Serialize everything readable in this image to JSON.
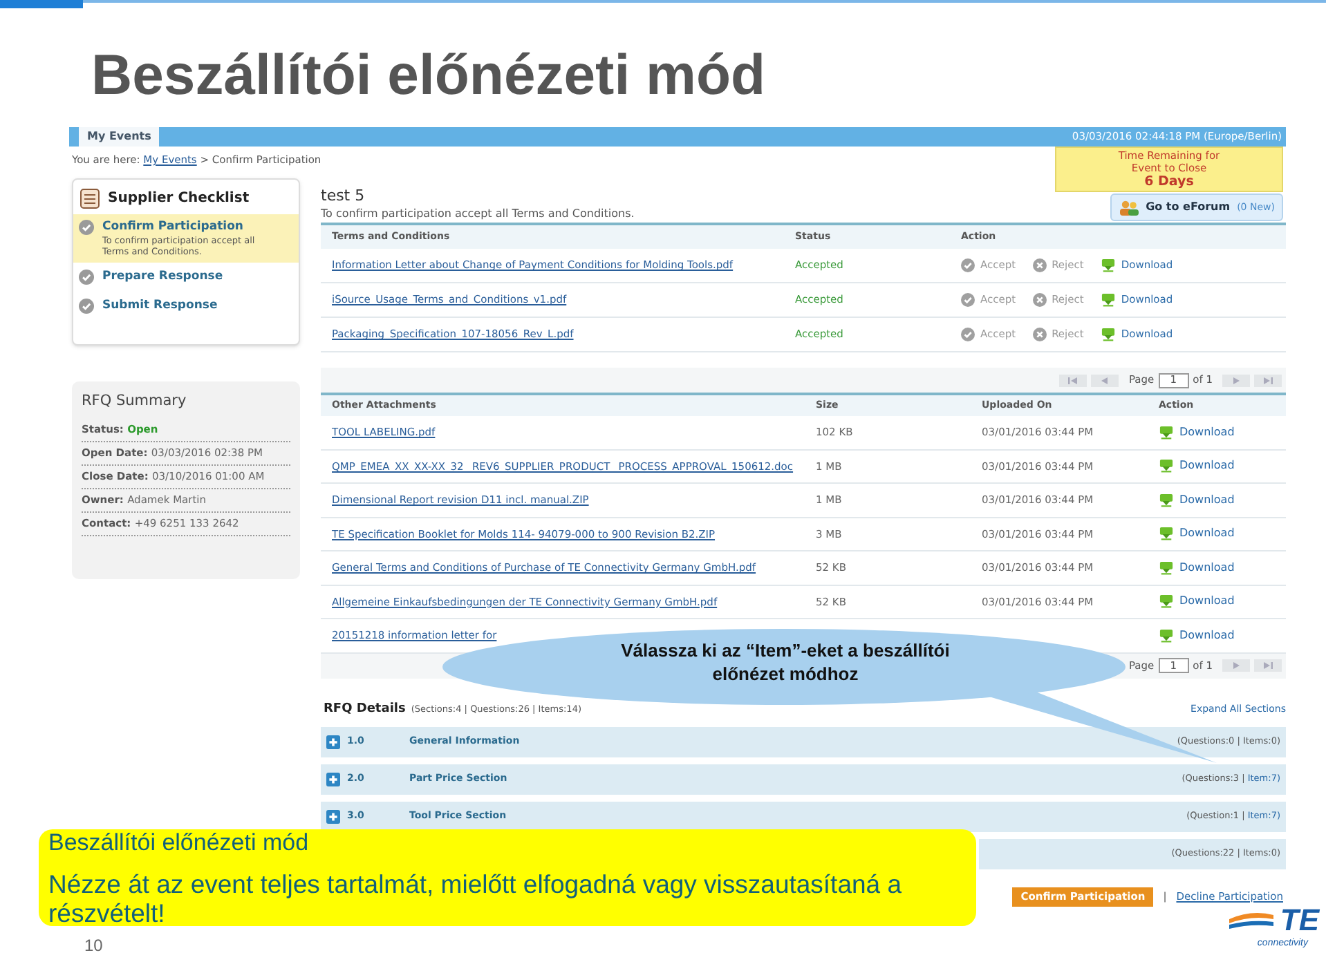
{
  "slide": {
    "title": "Beszállítói előnézeti mód",
    "page_number": "10"
  },
  "app": {
    "tab": "My Events",
    "datetime": "03/03/2016 02:44:18 PM (Europe/Berlin)",
    "breadcrumb": {
      "label": "You are here:",
      "link": "My Events",
      "separator": ">",
      "current": "Confirm Participation"
    }
  },
  "time_remaining": {
    "label": "Time Remaining for Event to Close",
    "value": "6 Days"
  },
  "checklist": {
    "title": "Supplier Checklist",
    "steps": [
      {
        "label": "Confirm Participation",
        "description": "To confirm participation accept all Terms and Conditions.",
        "selected": true
      },
      {
        "label": "Prepare Response",
        "selected": false
      },
      {
        "label": "Submit Response",
        "selected": false
      }
    ]
  },
  "rfq_summary": {
    "title": "RFQ Summary",
    "fields": [
      {
        "label": "Status:",
        "value": "Open",
        "kind": "status"
      },
      {
        "label": "Open Date:",
        "value": "03/03/2016 02:38 PM",
        "kind": "plain"
      },
      {
        "label": "Close Date:",
        "value": "03/10/2016 01:00 AM",
        "kind": "plain"
      },
      {
        "label": "Owner:",
        "value": "Adamek Martin",
        "kind": "plain"
      },
      {
        "label": "Contact:",
        "value": "+49 6251 133 2642",
        "kind": "plain"
      }
    ]
  },
  "event": {
    "name": "test 5",
    "instruction": "To confirm participation accept all Terms and Conditions."
  },
  "eforum_button": {
    "label": "Go to eForum",
    "badge": "(0 New)"
  },
  "terms_table": {
    "columns": [
      "Terms and Conditions",
      "Status",
      "Action"
    ],
    "rows": [
      {
        "name": "Information Letter about Change of Payment Conditions for Molding Tools.pdf",
        "status": "Accepted",
        "actions": [
          {
            "kind": "accept",
            "label": "Accept",
            "disabled": true
          },
          {
            "kind": "reject",
            "label": "Reject",
            "disabled": true
          },
          {
            "kind": "download",
            "label": "Download",
            "disabled": false
          }
        ]
      },
      {
        "name": "iSource_Usage_Terms_and_Conditions_v1.pdf",
        "status": "Accepted",
        "actions": [
          {
            "kind": "accept",
            "label": "Accept",
            "disabled": true
          },
          {
            "kind": "reject",
            "label": "Reject",
            "disabled": true
          },
          {
            "kind": "download",
            "label": "Download",
            "disabled": false
          }
        ]
      },
      {
        "name": "Packaging_Specification_107-18056_Rev_L.pdf",
        "status": "Accepted",
        "actions": [
          {
            "kind": "accept",
            "label": "Accept",
            "disabled": true
          },
          {
            "kind": "reject",
            "label": "Reject",
            "disabled": true
          },
          {
            "kind": "download",
            "label": "Download",
            "disabled": false
          }
        ]
      }
    ]
  },
  "pager_top": {
    "label": "Page",
    "value": "1",
    "total": "of 1"
  },
  "attachments_table": {
    "columns": [
      "Other Attachments",
      "Size",
      "Uploaded On",
      "Action"
    ],
    "rows": [
      {
        "name": "TOOL LABELING.pdf",
        "size": "102 KB",
        "uploaded": "03/01/2016 03:44 PM",
        "action": "Download"
      },
      {
        "name": "QMP_EMEA_XX_XX-XX_32 _REV6_SUPPLIER_PRODUCT _PROCESS_APPROVAL_150612.doc",
        "size": "1 MB",
        "uploaded": "03/01/2016 03:44 PM",
        "action": "Download"
      },
      {
        "name": "Dimensional Report revision D11 incl. manual.ZIP",
        "size": "1 MB",
        "uploaded": "03/01/2016 03:44 PM",
        "action": "Download"
      },
      {
        "name": "TE Specification Booklet for Molds 114- 94079-000 to 900 Revision B2.ZIP",
        "size": "3 MB",
        "uploaded": "03/01/2016 03:44 PM",
        "action": "Download"
      },
      {
        "name": "General Terms and Conditions of Purchase of TE Connectivity Germany GmbH.pdf",
        "size": "52 KB",
        "uploaded": "03/01/2016 03:44 PM",
        "action": "Download"
      },
      {
        "name": "Allgemeine Einkaufsbedingungen der TE Connectivity Germany GmbH.pdf",
        "size": "52 KB",
        "uploaded": "03/01/2016 03:44 PM",
        "action": "Download"
      },
      {
        "name": "20151218 information letter for",
        "action": "Download"
      }
    ]
  },
  "pager_bottom": {
    "label": "Page",
    "value": "1",
    "total": "of 1"
  },
  "rfq_details": {
    "title": "RFQ Details",
    "summary": "(Sections:4 | Questions:26 | Items:14)",
    "expand_link": "Expand All Sections",
    "sections": [
      {
        "number": "1.0",
        "title": "General Information",
        "questions": "(Questions:0 |",
        "items": "Items:0)",
        "items_link": false
      },
      {
        "number": "2.0",
        "title": "Part Price Section",
        "questions": "(Questions:3 |",
        "items": "Item:7)",
        "items_link": true
      },
      {
        "number": "3.0",
        "title": "Tool Price Section",
        "questions": "(Question:1 |",
        "items": "Item:7)",
        "items_link": true
      },
      {
        "questions": "(Questions:22 |",
        "items": "Items:0)",
        "items_link": false
      }
    ]
  },
  "footer_actions": {
    "confirm": "Confirm Participation",
    "separator": "|",
    "decline": "Decline Participation"
  },
  "callout": {
    "text": "Válassza ki az “Item”-eket a beszállítói\nelőnézet módhoz"
  },
  "note": {
    "title": "Beszállítói előnézeti mód",
    "body": "Nézze át az event teljes tartalmát, mielőtt elfogadná vagy visszautasítaná a részvételt!"
  },
  "logo": {
    "mark": "TE",
    "tagline": "connectivity"
  }
}
